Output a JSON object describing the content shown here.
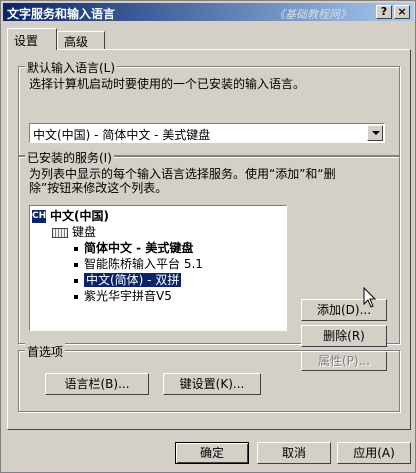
{
  "window": {
    "title": "文字服务和输入语言",
    "watermark": "《基础教程网》",
    "help_glyph": "?",
    "close_glyph": "×"
  },
  "tabs": [
    {
      "label": "设置",
      "active": true
    },
    {
      "label": "高级",
      "active": false
    }
  ],
  "default_language": {
    "group_label": "默认输入语言(L)",
    "description": "选择计算机启动时要使用的一个已安装的输入语言。",
    "selected": "中文(中国) - 简体中文 - 美式键盘"
  },
  "installed_services": {
    "group_label": "已安装的服务(I)",
    "description_line1": "为列表中显示的每个输入语言选择服务。使用“添加”和“删",
    "description_line2": "除”按钮来修改这个列表。",
    "tree": {
      "lang_badge": "CH",
      "language": "中文(中国)",
      "keyboard_label": "键盘",
      "items": [
        {
          "label": "简体中文 - 美式键盘",
          "bold": true,
          "selected": false
        },
        {
          "label": "智能陈桥输入平台  5.1",
          "bold": false,
          "selected": false
        },
        {
          "label": "中文(简体) - 双拼",
          "bold": false,
          "selected": true
        },
        {
          "label": "紫光华宇拼音V5",
          "bold": false,
          "selected": false
        }
      ]
    },
    "buttons": {
      "add": "添加(D)...",
      "remove": "删除(R)",
      "properties": "属性(P)..."
    }
  },
  "preferences": {
    "group_label": "首选项",
    "language_bar": "语言栏(B)...",
    "key_settings": "键设置(K)..."
  },
  "footer": {
    "ok": "确定",
    "cancel": "取消",
    "apply": "应用(A)"
  },
  "colors": {
    "selection": "#0a246a",
    "face": "#d4d0c8",
    "title_start": "#0a246a",
    "title_end": "#a6caf0"
  }
}
